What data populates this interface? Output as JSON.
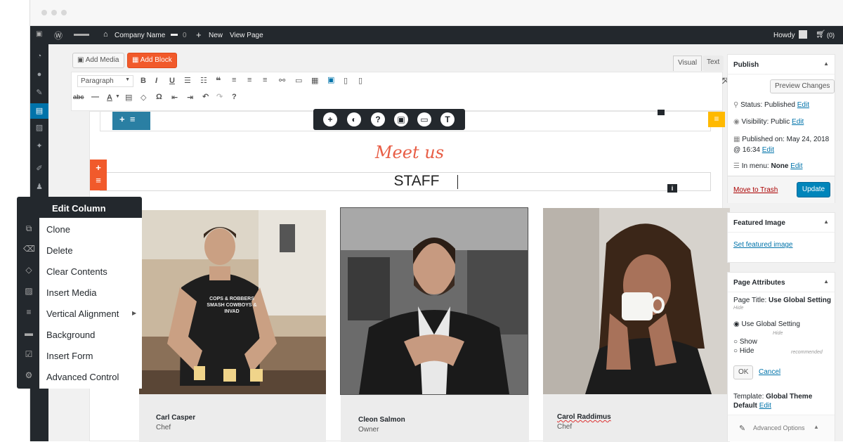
{
  "admin_bar": {
    "site_name": "Company Name",
    "comments_count": "0",
    "new_label": "New",
    "view_page_label": "View Page",
    "howdy_label": "Howdy",
    "cart_label": "(0)"
  },
  "editor": {
    "add_media_label": "Add Media",
    "add_block_label": "Add Block",
    "tab_visual": "Visual",
    "tab_text": "Text",
    "paragraph_select": "Paragraph",
    "heading_script": "Meet us",
    "heading_staff": "STAFF"
  },
  "context_menu": {
    "title": "Edit Column",
    "items": [
      "Clone",
      "Delete",
      "Clear Contents",
      "Insert Media",
      "Vertical Alignment",
      "Background",
      "Insert Form",
      "Advanced Control"
    ]
  },
  "staff": [
    {
      "name": "Carl Casper",
      "role": "Chef",
      "shirt_text": "COPS & ROBBERS SMASH COWBOYS & INVAD"
    },
    {
      "name": "Cleon Salmon",
      "role": "Owner"
    },
    {
      "name": "Carol Raddimus",
      "role": "Chef"
    }
  ],
  "publish": {
    "title": "Publish",
    "preview_label": "Preview Changes",
    "status_label": "Status:",
    "status_value": "Published",
    "visibility_label": "Visibility:",
    "visibility_value": "Public",
    "published_on_label": "Published on:",
    "published_on_value": "May 24, 2018",
    "published_time": "@ 16:34",
    "edit_label": "Edit",
    "in_menu_label": "In menu:",
    "in_menu_value": "None",
    "trash_label": "Move to Trash",
    "update_label": "Update"
  },
  "featured_image": {
    "title": "Featured Image",
    "set_label": "Set featured image"
  },
  "page_attributes": {
    "title": "Page Attributes",
    "page_title_label": "Page Title:",
    "page_title_value": "Use Global Setting",
    "hide_note": "Hide",
    "radio_global": "Use Global Setting",
    "radio_global_note": "Hide",
    "radio_show": "Show",
    "radio_hide": "Hide",
    "recommended": "recommended",
    "ok_label": "OK",
    "cancel_label": "Cancel",
    "template_label": "Template:",
    "template_value": "Global Theme Default",
    "advanced_options": "Advanced Options"
  },
  "colors": {
    "admin_dark": "#23282d",
    "wp_blue": "#0073aa",
    "block_orange": "#f15a2b",
    "teal": "#2a7fa3",
    "yellow": "#ffb900",
    "trash_red": "#a00"
  },
  "icons": [
    "wordpress-logo-icon",
    "home-icon",
    "comment-icon",
    "plus-icon",
    "cart-icon",
    "plus-circle-icon",
    "shield-icon",
    "help-icon",
    "image-icon",
    "layout-icon",
    "text-icon",
    "copy-icon",
    "eraser-icon",
    "gear-icon"
  ]
}
